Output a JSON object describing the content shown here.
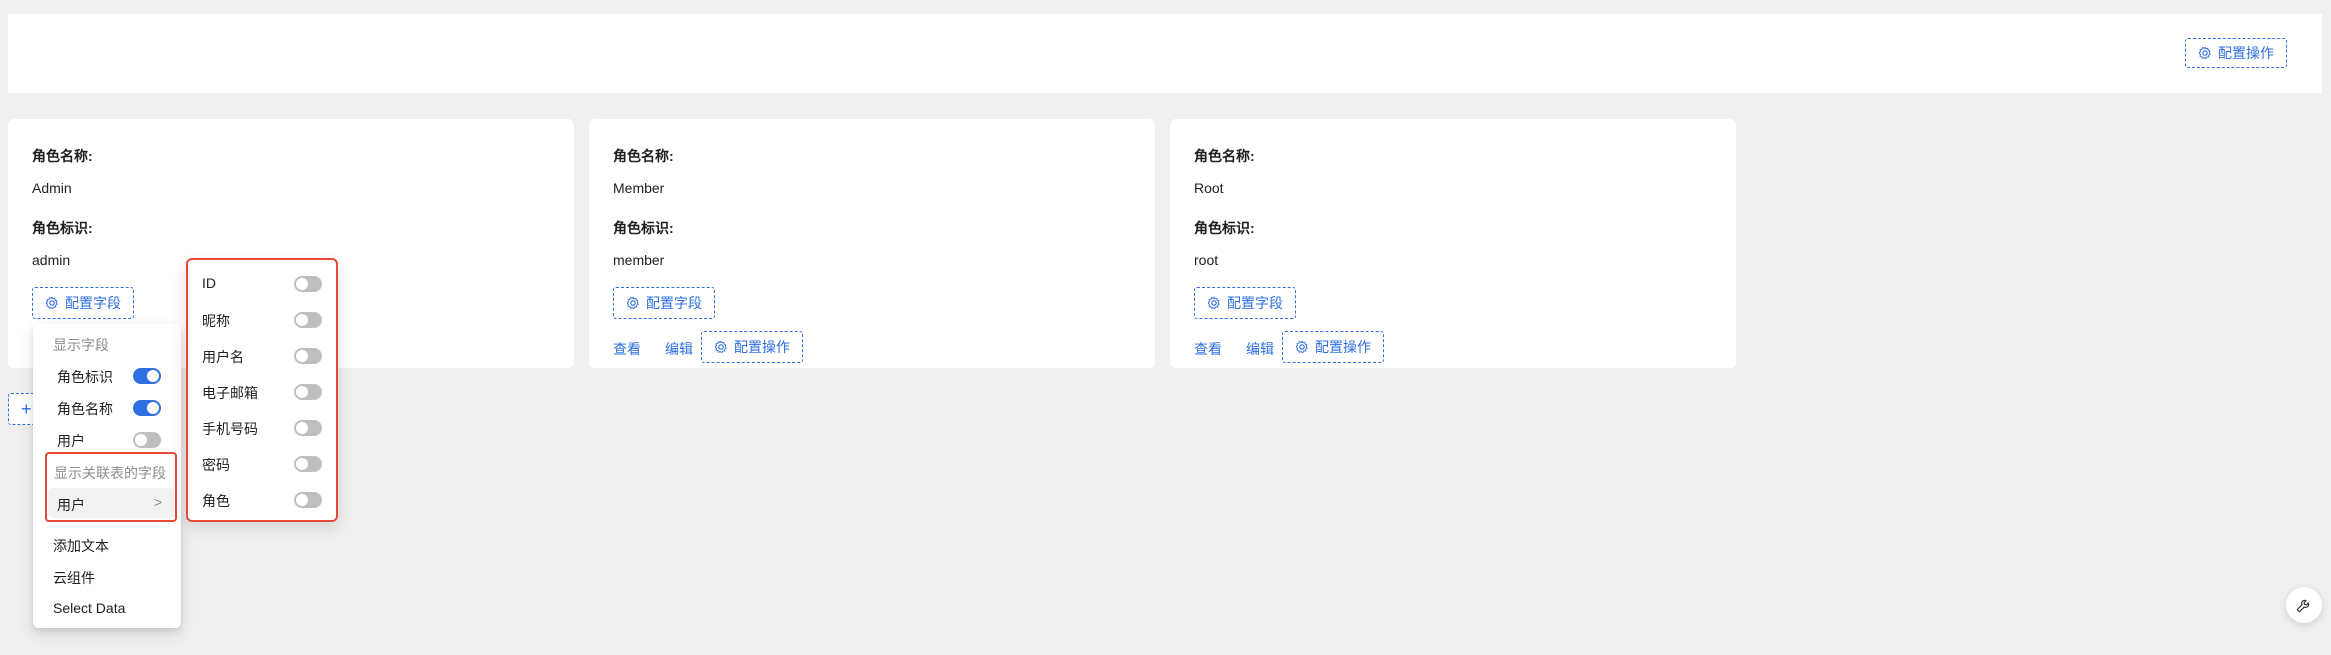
{
  "topbar": {
    "config_actions_label": "配置操作"
  },
  "cards": [
    {
      "name_label": "角色名称:",
      "name_value": "Admin",
      "id_label": "角色标识:",
      "id_value": "admin",
      "config_fields_label": "配置字段"
    },
    {
      "name_label": "角色名称:",
      "name_value": "Member",
      "id_label": "角色标识:",
      "id_value": "member",
      "config_fields_label": "配置字段",
      "view_label": "查看",
      "edit_label": "编辑",
      "config_actions_label": "配置操作"
    },
    {
      "name_label": "角色名称:",
      "name_value": "Root",
      "id_label": "角色标识:",
      "id_value": "root",
      "config_fields_label": "配置字段",
      "view_label": "查看",
      "edit_label": "编辑",
      "config_actions_label": "配置操作"
    }
  ],
  "menu": {
    "show_fields_group": "显示字段",
    "fields": [
      {
        "label": "角色标识",
        "on": true
      },
      {
        "label": "角色名称",
        "on": true
      },
      {
        "label": "用户",
        "on": false
      }
    ],
    "related_group": "显示关联表的字段",
    "related_item": "用户",
    "related_arrow": ">",
    "add_text": "添加文本",
    "cloud_component": "云组件",
    "select_data": "Select Data"
  },
  "submenu": {
    "items": [
      {
        "label": "ID",
        "on": false
      },
      {
        "label": "昵称",
        "on": false
      },
      {
        "label": "用户名",
        "on": false
      },
      {
        "label": "电子邮箱",
        "on": false
      },
      {
        "label": "手机号码",
        "on": false
      },
      {
        "label": "密码",
        "on": false
      },
      {
        "label": "角色",
        "on": false
      }
    ]
  },
  "partial_add_button": "+",
  "colors": {
    "accent": "#2f6fe0",
    "highlight": "#e24a3b",
    "toggle_off": "#bfbfbf"
  },
  "icons": {
    "gear": "gear-icon",
    "wrench": "wrench-icon"
  }
}
